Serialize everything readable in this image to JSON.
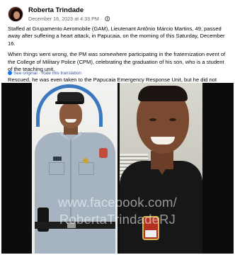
{
  "post": {
    "author": "Roberta Trindade",
    "timestamp": "December 16, 2023 at 4:33 PM",
    "separator": "·",
    "privacy_icon": "globe-icon",
    "paragraphs": [
      "Staffed at Grupamento Aeromobile (GAM), Lieutenant Antônio Márcio Martins, 49, passed away after suffering a heart attack, in Papucaia, on the morning of this Saturday, December 16.",
      "When things went wrong, the PM was somewhere participating in the fraternization event of the College of Military Police (CPM), celebrating the graduation of his son, who is a student of the teaching unit.",
      "Rescued, he was even taken to the Papucaia Emergency Response Unit, but he did not resist."
    ],
    "translation": {
      "see_original": "See original",
      "separator": "·",
      "rate": "Rate this translation"
    }
  },
  "media": {
    "watermark_line1": "www.facebook.com/",
    "watermark_line2": "RobertaTrindadeRJ"
  },
  "colors": {
    "link": "#385898",
    "meta": "#65676b",
    "accent": "#1877f2"
  }
}
